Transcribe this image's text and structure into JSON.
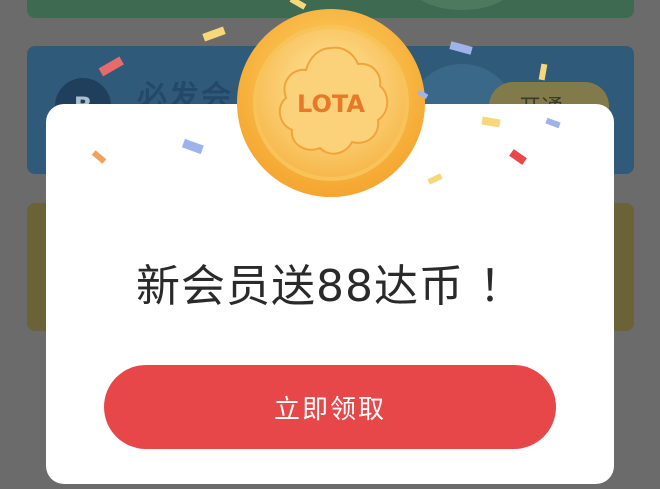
{
  "background": {
    "card_title": "必发会",
    "card_badge": "B",
    "card_button": "开通"
  },
  "coin": {
    "logo_text": "LOTA"
  },
  "modal": {
    "title": "新会员送88达币 ！",
    "claim_button": "立即领取"
  },
  "colors": {
    "accent_red": "#e8474a",
    "coin_gold": "#f6b444",
    "modal_bg": "#ffffff"
  }
}
